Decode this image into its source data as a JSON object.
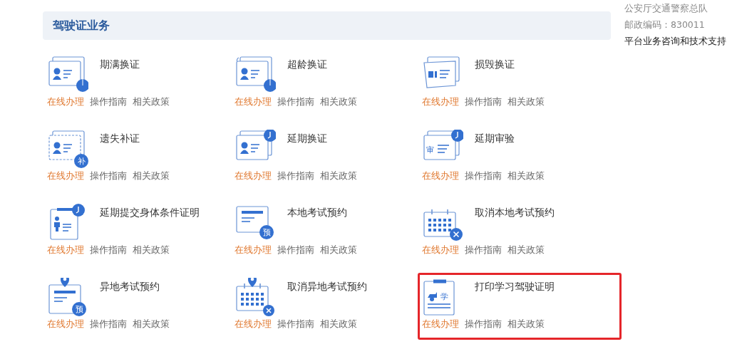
{
  "section": {
    "title": "驾驶证业务"
  },
  "contact": [
    "公安厅交通警察总队",
    "邮政编码：830011",
    "平台业务咨询和技术支持"
  ],
  "services": [
    {
      "title": "期满换证",
      "icon": {
        "kind": "card-pie"
      },
      "links": [
        "在线办理",
        "操作指南",
        "相关政策"
      ],
      "highlighted": false
    },
    {
      "title": "超龄换证",
      "icon": {
        "kind": "card-refresh-pie"
      },
      "links": [
        "在线办理",
        "操作指南",
        "相关政策"
      ],
      "highlighted": false
    },
    {
      "title": "损毁换证",
      "icon": {
        "kind": "card-damaged"
      },
      "links": [
        "在线办理",
        "操作指南",
        "相关政策"
      ],
      "highlighted": false
    },
    {
      "title": "遗失补证",
      "icon": {
        "kind": "card-dashed",
        "badge": "补"
      },
      "links": [
        "在线办理",
        "操作指南",
        "相关政策"
      ],
      "highlighted": false
    },
    {
      "title": "延期换证",
      "icon": {
        "kind": "card-clock"
      },
      "links": [
        "在线办理",
        "操作指南",
        "相关政策"
      ],
      "highlighted": false
    },
    {
      "title": "延期审验",
      "icon": {
        "kind": "review-clock",
        "badge": "审"
      },
      "links": [
        "在线办理",
        "操作指南",
        "相关政策"
      ],
      "highlighted": false
    },
    {
      "title": "延期提交身体条件证明",
      "icon": {
        "kind": "person-clock"
      },
      "links": [
        "在线办理",
        "操作指南",
        "相关政策"
      ],
      "highlighted": false
    },
    {
      "title": "本地考试预约",
      "icon": {
        "kind": "form-badge",
        "badge": "预"
      },
      "links": [
        "在线办理",
        "操作指南",
        "相关政策"
      ],
      "highlighted": false
    },
    {
      "title": "取消本地考试预约",
      "icon": {
        "kind": "calendar-x"
      },
      "links": [
        "在线办理",
        "操作指南",
        "相关政策"
      ],
      "highlighted": false
    },
    {
      "title": "异地考试预约",
      "icon": {
        "kind": "pin-form-badge",
        "badge": "预"
      },
      "links": [
        "在线办理",
        "操作指南",
        "相关政策"
      ],
      "highlighted": false
    },
    {
      "title": "取消异地考试预约",
      "icon": {
        "kind": "pin-calendar-x"
      },
      "links": [
        "在线办理",
        "操作指南",
        "相关政策"
      ],
      "highlighted": false
    },
    {
      "title": "打印学习驾驶证明",
      "icon": {
        "kind": "car-form",
        "badge": "学"
      },
      "links": [
        "在线办理",
        "操作指南",
        "相关政策"
      ],
      "highlighted": true
    }
  ]
}
